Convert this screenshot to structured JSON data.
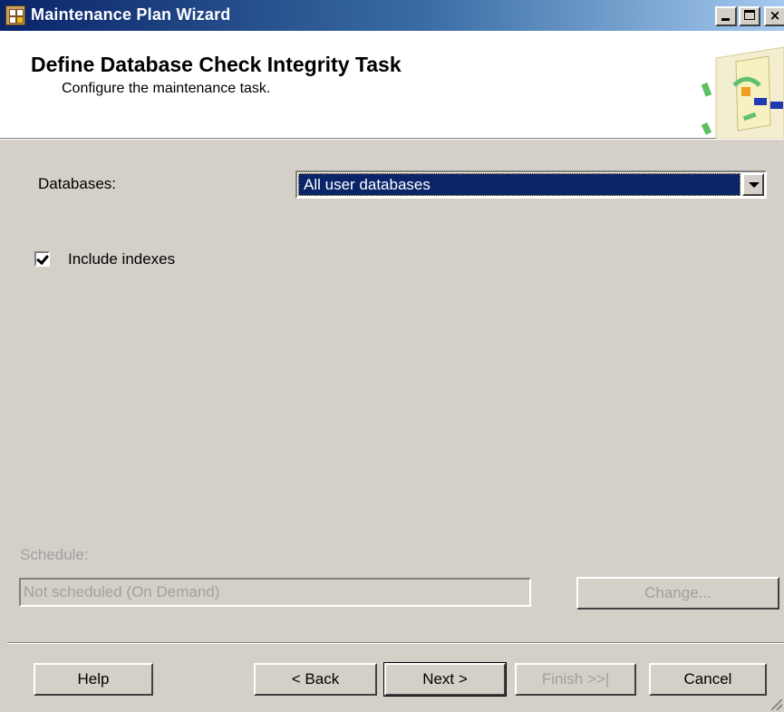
{
  "window": {
    "title": "Maintenance Plan Wizard",
    "icon": "maintenance-plan-icon",
    "controls": [
      "minimize-icon",
      "maximize-icon",
      "close-icon"
    ]
  },
  "header": {
    "title": "Define Database Check Integrity Task",
    "subtitle": "Configure the maintenance task.",
    "graphic": "wizard-banner-graphic"
  },
  "form": {
    "databases_label": "Databases:",
    "databases_value": "All user databases",
    "include_indexes_label": "Include indexes",
    "include_indexes_checked": true
  },
  "schedule": {
    "label": "Schedule:",
    "value": "Not scheduled (On Demand)",
    "change_label": "Change...",
    "enabled": false
  },
  "buttons": {
    "help": "Help",
    "back": "< Back",
    "next": "Next >",
    "finish": "Finish >>|",
    "cancel": "Cancel"
  },
  "colors": {
    "title_bar_start": "#0a246a",
    "title_bar_end": "#a6caf0",
    "selection": "#0a246a",
    "dialog_face": "#d4d0c8",
    "disabled_text": "#a0a0a0"
  }
}
